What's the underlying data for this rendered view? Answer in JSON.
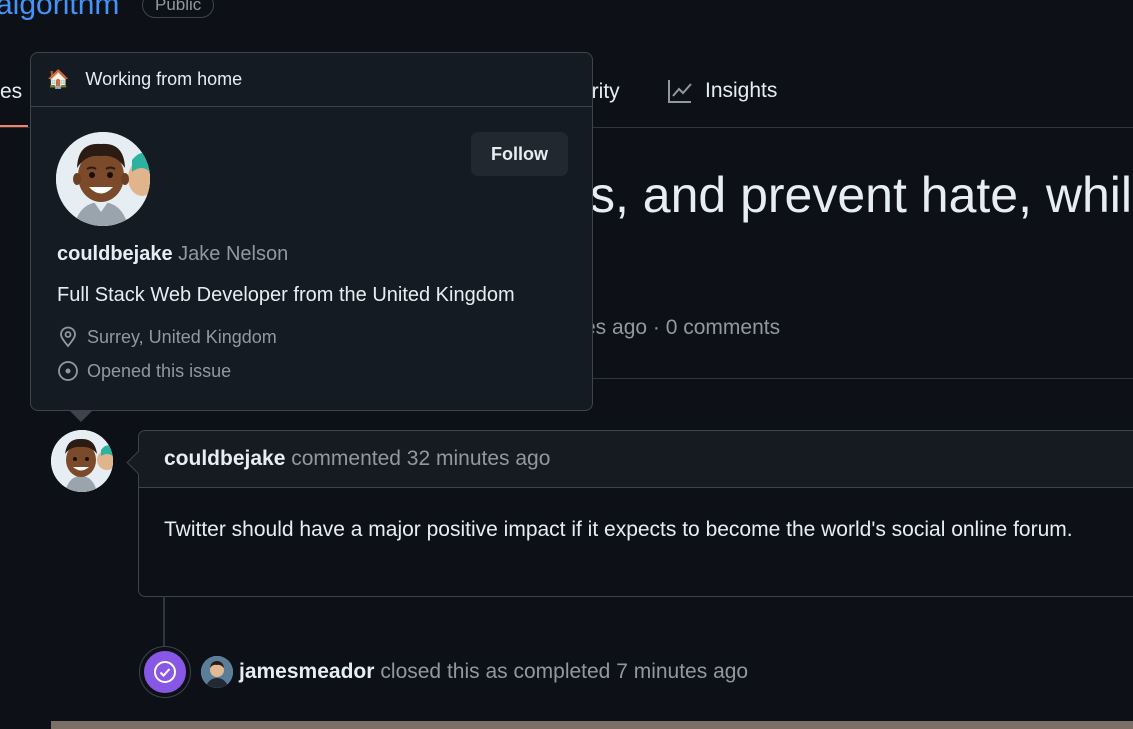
{
  "repo": {
    "name": "algorithm",
    "visibility": "Public"
  },
  "tabs": {
    "left_partial": "es",
    "security_partial": "urity",
    "insights": "Insights"
  },
  "issue": {
    "title_partial": "s, and prevent hate, whils",
    "meta_partial": "es ago · 0 comments"
  },
  "hovercard": {
    "status_emoji": "🏠",
    "status_text": "Working from home",
    "follow_label": "Follow",
    "login": "couldbejake",
    "full_name": "Jake Nelson",
    "bio": "Full Stack Web Developer from the United Kingdom",
    "location": "Surrey, United Kingdom",
    "relation": "Opened this issue"
  },
  "comment": {
    "author": "couldbejake",
    "action": "commented 32 minutes ago",
    "body": "Twitter should have a major positive impact if it expects to become the world's social online forum."
  },
  "event": {
    "actor": "jamesmeador",
    "text": "closed this as completed 7 minutes ago"
  },
  "colors": {
    "link": "#4493f8",
    "closed": "#8957e5",
    "tab_active": "#f78166"
  }
}
